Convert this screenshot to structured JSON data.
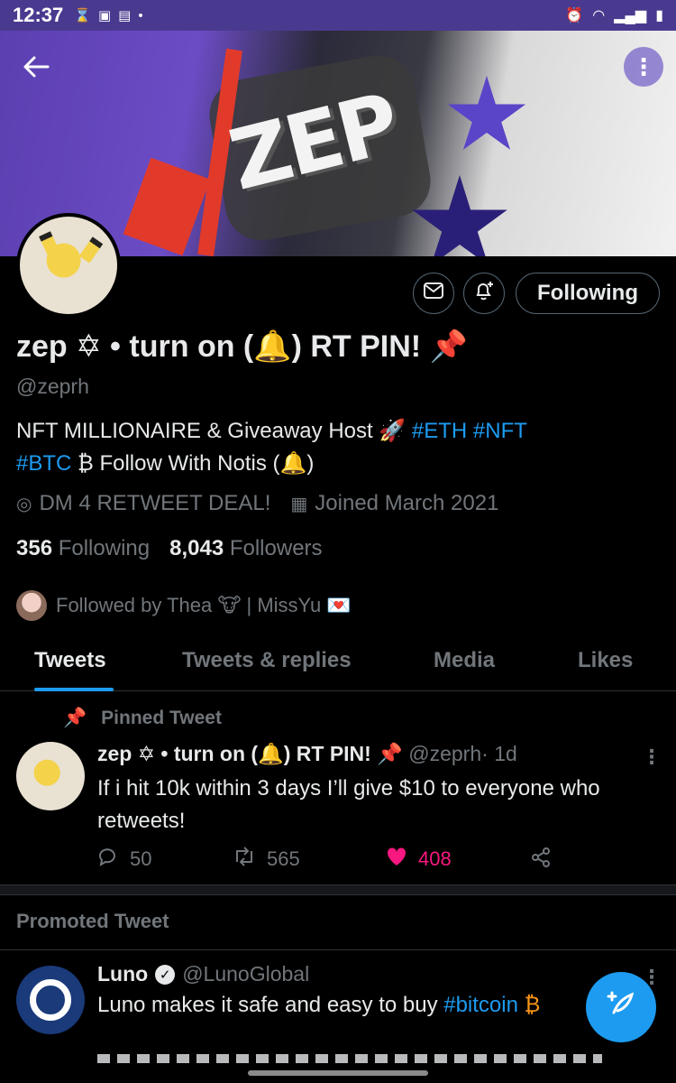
{
  "status_bar": {
    "time": "12:37",
    "left_icons": [
      "hourglass-icon",
      "image-icon",
      "webtoon-icon",
      "dot-icon"
    ],
    "right_icons": [
      "alarm-icon",
      "wifi-icon",
      "signal-icon",
      "battery-icon"
    ]
  },
  "banner": {
    "graffiti_text": "ZEP"
  },
  "profile": {
    "display_name": "zep ✡ • turn on (🔔) RT PIN! 📌",
    "handle": "@zeprh",
    "bio_part1": "NFT MILLIONAIRE & Giveaway Host 🚀 ",
    "bio_tag1": "#ETH",
    "bio_tag2": "#NFT",
    "bio_tag3": "#BTC",
    "bio_part2": " ₿  Follow With Notis (🔔)",
    "location": "DM 4 RETWEET DEAL!",
    "joined": "Joined March 2021",
    "following_count": "356",
    "following_label": "Following",
    "followers_count": "8,043",
    "followers_label": "Followers",
    "followed_by": "Followed by Thea 🐮 | MissYu 💌"
  },
  "actions": {
    "follow_label": "Following"
  },
  "tabs": [
    {
      "label": "Tweets",
      "active": true
    },
    {
      "label": "Tweets & replies",
      "active": false
    },
    {
      "label": "Media",
      "active": false
    },
    {
      "label": "Likes",
      "active": false
    }
  ],
  "pinned_tweet": {
    "label": "Pinned Tweet",
    "author": "zep ✡ • turn on (🔔) RT PIN! 📌",
    "handle": "@zeprh",
    "time": "· 1d",
    "text": "If i hit 10k within 3 days I’ll give $10 to everyone who retweets!",
    "replies": "50",
    "retweets": "565",
    "likes": "408"
  },
  "promoted": {
    "label": "Promoted Tweet",
    "author": "Luno",
    "handle": "@LunoGlobal",
    "text_part1": "Luno makes it safe and easy to buy ",
    "text_tag": "#bitcoin",
    "text_part2": " ₿"
  },
  "colors": {
    "accent": "#1d9bf0",
    "like": "#f91880",
    "status_bar": "#4a3a8f",
    "background": "#000000",
    "secondary_text": "#71767b"
  }
}
